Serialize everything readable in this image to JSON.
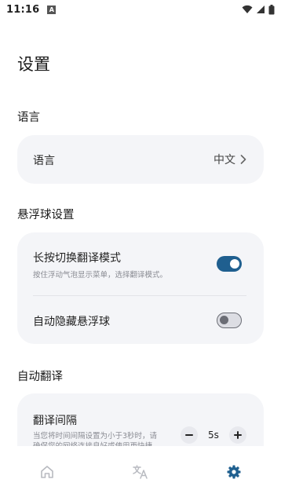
{
  "status_bar": {
    "time": "11:16",
    "notification_glyph": "A",
    "icons": [
      "wifi-icon",
      "signal-icon",
      "battery-icon"
    ]
  },
  "page": {
    "title": "设置"
  },
  "sections": {
    "language": {
      "title": "语言",
      "row_label": "语言",
      "row_value": "中文"
    },
    "floating_ball": {
      "title": "悬浮球设置",
      "long_press": {
        "label": "长按切换翻译模式",
        "description": "按住浮动气泡显示菜单，选择翻译模式。",
        "enabled": true
      },
      "auto_hide": {
        "label": "自动隐藏悬浮球",
        "enabled": false
      }
    },
    "auto_translate": {
      "title": "自动翻译",
      "interval": {
        "label": "翻译间隔",
        "description_line1": "当您将时间间隔设置为小于3秒时，请",
        "description_line2": "确保您的网络连接良好或使用更快捷",
        "value": "5s"
      }
    }
  },
  "bottom_nav": {
    "items": [
      {
        "name": "home",
        "icon": "home-icon",
        "active": false
      },
      {
        "name": "translate",
        "icon": "translate-icon",
        "active": false
      },
      {
        "name": "settings",
        "icon": "gear-icon",
        "active": true
      }
    ]
  },
  "colors": {
    "accent": "#1f5f8f",
    "card_bg": "#f4f5f8",
    "inactive_icon": "#b8bac0"
  }
}
